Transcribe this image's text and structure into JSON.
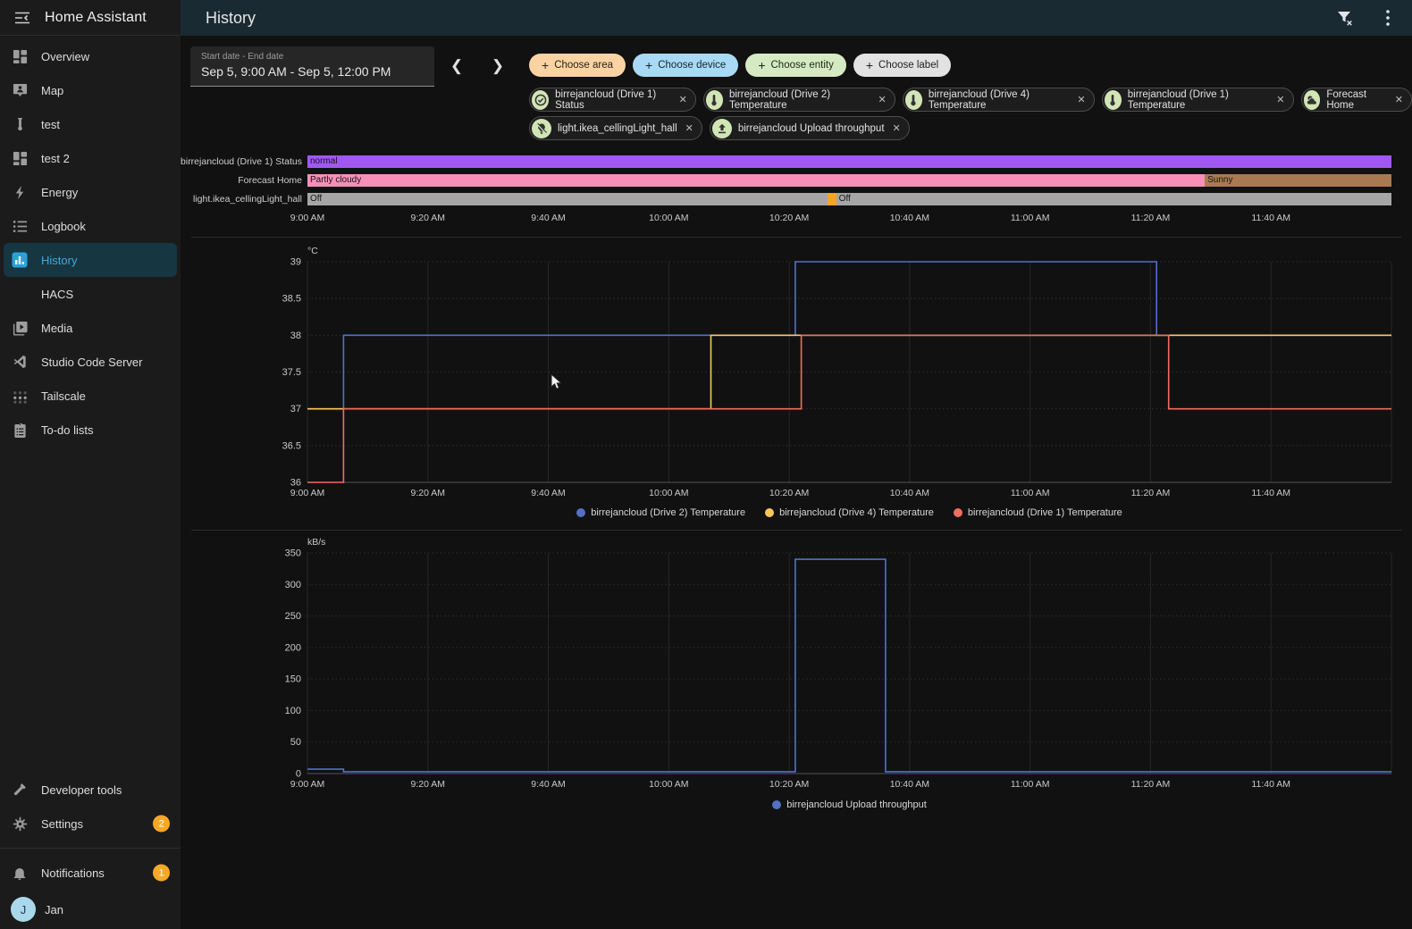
{
  "sidebar": {
    "title": "Home Assistant",
    "items": [
      {
        "label": "Overview",
        "icon": "view-dashboard"
      },
      {
        "label": "Map",
        "icon": "map-account"
      },
      {
        "label": "test",
        "icon": "test-tube"
      },
      {
        "label": "test 2",
        "icon": "view-dashboard"
      },
      {
        "label": "Energy",
        "icon": "lightning-bolt"
      },
      {
        "label": "Logbook",
        "icon": "format-list"
      },
      {
        "label": "History",
        "icon": "chart-bar",
        "selected": true
      },
      {
        "label": "HACS",
        "icon": "none"
      },
      {
        "label": "Media",
        "icon": "play-box"
      },
      {
        "label": "Studio Code Server",
        "icon": "vscode"
      },
      {
        "label": "Tailscale",
        "icon": "tailscale-dots"
      },
      {
        "label": "To-do lists",
        "icon": "clipboard-list"
      }
    ],
    "bottom_items": [
      {
        "label": "Developer tools",
        "icon": "hammer",
        "badge": ""
      },
      {
        "label": "Settings",
        "icon": "gear",
        "badge": "2"
      },
      {
        "label": "Notifications",
        "icon": "bell",
        "badge": "1"
      }
    ],
    "user": {
      "name": "Jan",
      "avatar_initial": "J"
    }
  },
  "header": {
    "title": "History"
  },
  "controls": {
    "date_range": {
      "label": "Start date - End date",
      "value": "Sep 5, 9:00 AM - Sep 5, 12:00 PM"
    },
    "filter_chips": [
      {
        "label": "Choose area",
        "bg": "#fbd3a3",
        "fg": "#2a2115"
      },
      {
        "label": "Choose device",
        "bg": "#a9daf5",
        "fg": "#13262f"
      },
      {
        "label": "Choose entity",
        "bg": "#d5e9c3",
        "fg": "#1d2914"
      },
      {
        "label": "Choose label",
        "bg": "#e2e2e2",
        "fg": "#222222"
      }
    ],
    "entity_chips": [
      {
        "label": "birrejancloud (Drive 1) Status",
        "icon": "check-circle"
      },
      {
        "label": "birrejancloud (Drive 2) Temperature",
        "icon": "thermometer"
      },
      {
        "label": "birrejancloud (Drive 4) Temperature",
        "icon": "thermometer"
      },
      {
        "label": "birrejancloud (Drive 1) Temperature",
        "icon": "thermometer"
      },
      {
        "label": "Forecast Home",
        "icon": "weather-partly-cloudy"
      },
      {
        "label": "light.ikea_cellingLight_hall",
        "icon": "lightbulb-off"
      },
      {
        "label": "birrejancloud Upload throughput",
        "icon": "upload"
      }
    ]
  },
  "timeline": {
    "window_minutes": 180,
    "x_ticks": [
      "9:00 AM",
      "9:20 AM",
      "9:40 AM",
      "10:00 AM",
      "10:20 AM",
      "10:40 AM",
      "11:00 AM",
      "11:20 AM",
      "11:40 AM"
    ],
    "rows": [
      {
        "label": "birrejancloud (Drive 1) Status",
        "segments": [
          {
            "text": "normal",
            "color": "#a158f0",
            "start": 0,
            "end": 180
          }
        ]
      },
      {
        "label": "Forecast Home",
        "segments": [
          {
            "text": "Partly cloudy",
            "color": "#f78fb9",
            "start": 0,
            "end": 149
          },
          {
            "text": "Sunny",
            "color": "#a97a52",
            "start": 149,
            "end": 180
          }
        ]
      },
      {
        "label": "light.ikea_cellingLight_hall",
        "segments": [
          {
            "text": "Off",
            "color": "#a6a6a6",
            "start": 0,
            "end": 86.4
          },
          {
            "text": "",
            "color": "#f4a522",
            "start": 86.4,
            "end": 87.8
          },
          {
            "text": "Off",
            "color": "#a6a6a6",
            "start": 87.8,
            "end": 180
          }
        ]
      }
    ]
  },
  "chart_data": [
    {
      "type": "line",
      "step": true,
      "title": "Temperature history",
      "ylabel": "°C",
      "ylim": [
        36,
        39
      ],
      "y_ticks": [
        36,
        36.5,
        37,
        37.5,
        38,
        38.5,
        39
      ],
      "x_range": [
        0,
        180
      ],
      "x_unit": "minutes after 9:00 AM",
      "x_ticks": [
        {
          "v": 0,
          "label": "9:00 AM"
        },
        {
          "v": 20,
          "label": "9:20 AM"
        },
        {
          "v": 40,
          "label": "9:40 AM"
        },
        {
          "v": 60,
          "label": "10:00 AM"
        },
        {
          "v": 80,
          "label": "10:20 AM"
        },
        {
          "v": 100,
          "label": "10:40 AM"
        },
        {
          "v": 120,
          "label": "11:00 AM"
        },
        {
          "v": 140,
          "label": "11:20 AM"
        },
        {
          "v": 160,
          "label": "11:40 AM"
        }
      ],
      "series": [
        {
          "name": "birrejancloud (Drive 2) Temperature",
          "color": "#5470c6",
          "points": [
            [
              0,
              37
            ],
            [
              6,
              37
            ],
            [
              6,
              38
            ],
            [
              81,
              38
            ],
            [
              81,
              39
            ],
            [
              141,
              39
            ],
            [
              141,
              38
            ],
            [
              180,
              38
            ]
          ]
        },
        {
          "name": "birrejancloud (Drive 4) Temperature",
          "color": "#fac858",
          "points": [
            [
              0,
              37
            ],
            [
              67,
              37
            ],
            [
              67,
              38
            ],
            [
              180,
              38
            ]
          ]
        },
        {
          "name": "birrejancloud (Drive 1) Temperature",
          "color": "#ee6e60",
          "points": [
            [
              0,
              36
            ],
            [
              6,
              36
            ],
            [
              6,
              37
            ],
            [
              82,
              37
            ],
            [
              82,
              38
            ],
            [
              143,
              38
            ],
            [
              143,
              37
            ],
            [
              180,
              37
            ]
          ]
        }
      ],
      "legend_position": "bottom-center",
      "grid": true
    },
    {
      "type": "line",
      "step": true,
      "title": "Upload throughput history",
      "ylabel": "kB/s",
      "ylim": [
        0,
        350
      ],
      "y_ticks": [
        0,
        50,
        100,
        150,
        200,
        250,
        300,
        350
      ],
      "x_range": [
        0,
        180
      ],
      "x_unit": "minutes after 9:00 AM",
      "x_ticks": [
        {
          "v": 0,
          "label": "9:00 AM"
        },
        {
          "v": 20,
          "label": "9:20 AM"
        },
        {
          "v": 40,
          "label": "9:40 AM"
        },
        {
          "v": 60,
          "label": "10:00 AM"
        },
        {
          "v": 80,
          "label": "10:20 AM"
        },
        {
          "v": 100,
          "label": "10:40 AM"
        },
        {
          "v": 120,
          "label": "11:00 AM"
        },
        {
          "v": 140,
          "label": "11:20 AM"
        },
        {
          "v": 160,
          "label": "11:40 AM"
        }
      ],
      "series": [
        {
          "name": "birrejancloud Upload throughput",
          "color": "#5470c6",
          "points": [
            [
              0,
              7
            ],
            [
              6,
              7
            ],
            [
              6,
              3
            ],
            [
              81,
              3
            ],
            [
              81,
              340
            ],
            [
              96,
              340
            ],
            [
              96,
              3
            ],
            [
              180,
              3
            ]
          ]
        }
      ],
      "legend_position": "bottom-center",
      "grid": true
    }
  ]
}
